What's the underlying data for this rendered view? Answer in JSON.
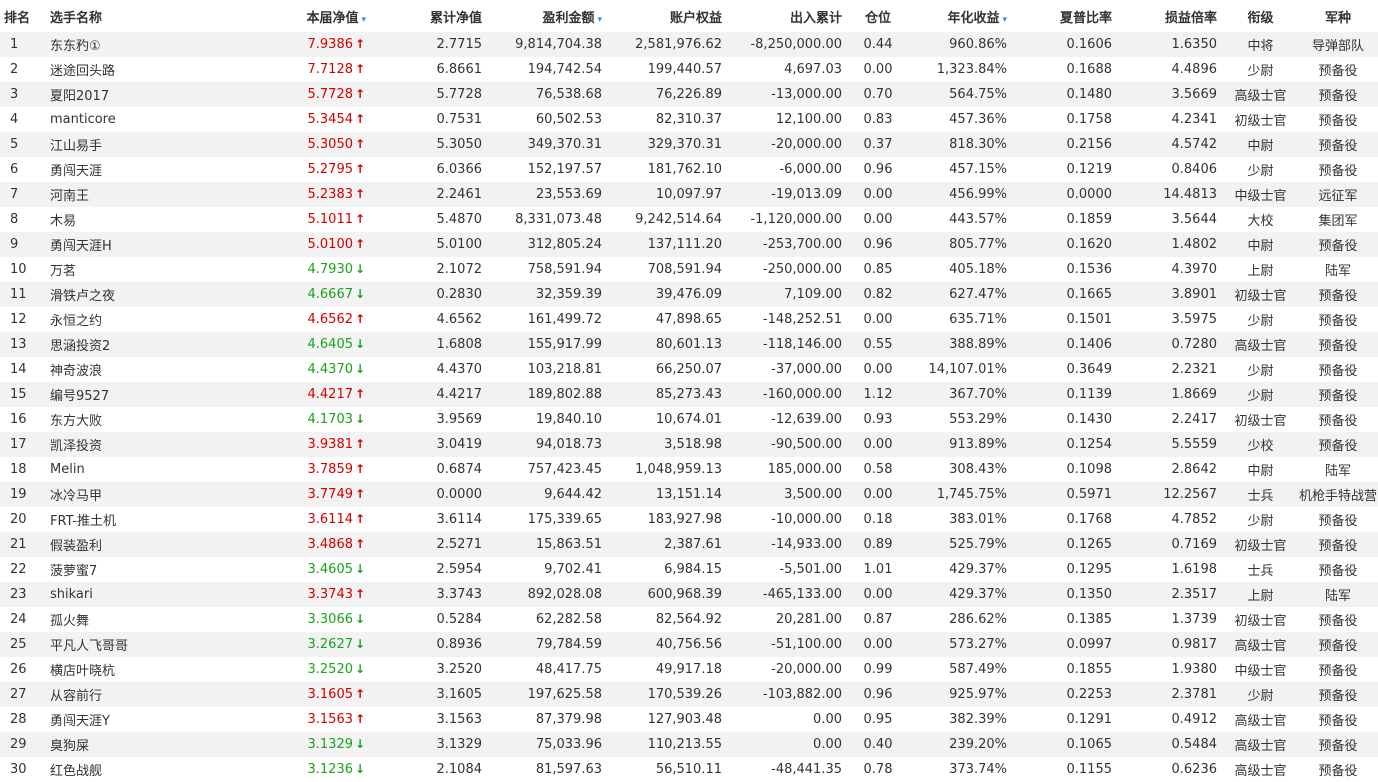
{
  "headers": {
    "rank": "排名",
    "name": "选手名称",
    "nav": "本届净值",
    "cum_nav": "累计净值",
    "profit": "盈利金额",
    "equity": "账户权益",
    "flow": "出入累计",
    "position": "仓位",
    "annual": "年化收益",
    "sharpe": "夏普比率",
    "pl_ratio": "损益倍率",
    "rank_title": "衔级",
    "branch": "军种",
    "sort_icon": "▾"
  },
  "colors": {
    "up": "#d40000",
    "down": "#1aa31a",
    "sort": "#3a8ee6",
    "stripe": "#f2f2f2"
  },
  "rows": [
    {
      "rank": "1",
      "name": "东东䂆①",
      "nav": "7.9386",
      "dir": "up",
      "cum": "2.7715",
      "profit": "9,814,704.38",
      "equity": "2,581,976.62",
      "flow": "-8,250,000.00",
      "pos": "0.44",
      "annual": "960.86%",
      "sharpe": "0.1606",
      "pl": "1.6350",
      "title": "中将",
      "branch": "导弹部队"
    },
    {
      "rank": "2",
      "name": "迷途回头路",
      "nav": "7.7128",
      "dir": "up",
      "cum": "6.8661",
      "profit": "194,742.54",
      "equity": "199,440.57",
      "flow": "4,697.03",
      "pos": "0.00",
      "annual": "1,323.84%",
      "sharpe": "0.1688",
      "pl": "4.4896",
      "title": "少尉",
      "branch": "预备役"
    },
    {
      "rank": "3",
      "name": "夏阳2017",
      "nav": "5.7728",
      "dir": "up",
      "cum": "5.7728",
      "profit": "76,538.68",
      "equity": "76,226.89",
      "flow": "-13,000.00",
      "pos": "0.70",
      "annual": "564.75%",
      "sharpe": "0.1480",
      "pl": "3.5669",
      "title": "高级士官",
      "branch": "预备役"
    },
    {
      "rank": "4",
      "name": "manticore",
      "nav": "5.3454",
      "dir": "up",
      "cum": "0.7531",
      "profit": "60,502.53",
      "equity": "82,310.37",
      "flow": "12,100.00",
      "pos": "0.83",
      "annual": "457.36%",
      "sharpe": "0.1758",
      "pl": "4.2341",
      "title": "初级士官",
      "branch": "预备役"
    },
    {
      "rank": "5",
      "name": "江山易手",
      "nav": "5.3050",
      "dir": "up",
      "cum": "5.3050",
      "profit": "349,370.31",
      "equity": "329,370.31",
      "flow": "-20,000.00",
      "pos": "0.37",
      "annual": "818.30%",
      "sharpe": "0.2156",
      "pl": "4.5742",
      "title": "中尉",
      "branch": "预备役"
    },
    {
      "rank": "6",
      "name": "勇闯天涯",
      "nav": "5.2795",
      "dir": "up",
      "cum": "6.0366",
      "profit": "152,197.57",
      "equity": "181,762.10",
      "flow": "-6,000.00",
      "pos": "0.96",
      "annual": "457.15%",
      "sharpe": "0.1219",
      "pl": "0.8406",
      "title": "少尉",
      "branch": "预备役"
    },
    {
      "rank": "7",
      "name": "河南王",
      "nav": "5.2383",
      "dir": "up",
      "cum": "2.2461",
      "profit": "23,553.69",
      "equity": "10,097.97",
      "flow": "-19,013.09",
      "pos": "0.00",
      "annual": "456.99%",
      "sharpe": "0.0000",
      "pl": "14.4813",
      "title": "中级士官",
      "branch": "远征军"
    },
    {
      "rank": "8",
      "name": "木易",
      "nav": "5.1011",
      "dir": "up",
      "cum": "5.4870",
      "profit": "8,331,073.48",
      "equity": "9,242,514.64",
      "flow": "-1,120,000.00",
      "pos": "0.00",
      "annual": "443.57%",
      "sharpe": "0.1859",
      "pl": "3.5644",
      "title": "大校",
      "branch": "集团军"
    },
    {
      "rank": "9",
      "name": "勇闯天涯H",
      "nav": "5.0100",
      "dir": "up",
      "cum": "5.0100",
      "profit": "312,805.24",
      "equity": "137,111.20",
      "flow": "-253,700.00",
      "pos": "0.96",
      "annual": "805.77%",
      "sharpe": "0.1620",
      "pl": "1.4802",
      "title": "中尉",
      "branch": "预备役"
    },
    {
      "rank": "10",
      "name": "万茗",
      "nav": "4.7930",
      "dir": "down",
      "cum": "2.1072",
      "profit": "758,591.94",
      "equity": "708,591.94",
      "flow": "-250,000.00",
      "pos": "0.85",
      "annual": "405.18%",
      "sharpe": "0.1536",
      "pl": "4.3970",
      "title": "上尉",
      "branch": "陆军"
    },
    {
      "rank": "11",
      "name": "滑铁卢之夜",
      "nav": "4.6667",
      "dir": "down",
      "cum": "0.2830",
      "profit": "32,359.39",
      "equity": "39,476.09",
      "flow": "7,109.00",
      "pos": "0.82",
      "annual": "627.47%",
      "sharpe": "0.1665",
      "pl": "3.8901",
      "title": "初级士官",
      "branch": "预备役"
    },
    {
      "rank": "12",
      "name": "永恒之约",
      "nav": "4.6562",
      "dir": "up",
      "cum": "4.6562",
      "profit": "161,499.72",
      "equity": "47,898.65",
      "flow": "-148,252.51",
      "pos": "0.00",
      "annual": "635.71%",
      "sharpe": "0.1501",
      "pl": "3.5975",
      "title": "少尉",
      "branch": "预备役"
    },
    {
      "rank": "13",
      "name": "思涵投资2",
      "nav": "4.6405",
      "dir": "down",
      "cum": "1.6808",
      "profit": "155,917.99",
      "equity": "80,601.13",
      "flow": "-118,146.00",
      "pos": "0.55",
      "annual": "388.89%",
      "sharpe": "0.1406",
      "pl": "0.7280",
      "title": "高级士官",
      "branch": "预备役"
    },
    {
      "rank": "14",
      "name": "神奇波浪",
      "nav": "4.4370",
      "dir": "down",
      "cum": "4.4370",
      "profit": "103,218.81",
      "equity": "66,250.07",
      "flow": "-37,000.00",
      "pos": "0.00",
      "annual": "14,107.01%",
      "sharpe": "0.3649",
      "pl": "2.2321",
      "title": "少尉",
      "branch": "预备役"
    },
    {
      "rank": "15",
      "name": "编号9527",
      "nav": "4.4217",
      "dir": "up",
      "cum": "4.4217",
      "profit": "189,802.88",
      "equity": "85,273.43",
      "flow": "-160,000.00",
      "pos": "1.12",
      "annual": "367.70%",
      "sharpe": "0.1139",
      "pl": "1.8669",
      "title": "少尉",
      "branch": "预备役"
    },
    {
      "rank": "16",
      "name": "东方大败",
      "nav": "4.1703",
      "dir": "down",
      "cum": "3.9569",
      "profit": "19,840.10",
      "equity": "10,674.01",
      "flow": "-12,639.00",
      "pos": "0.93",
      "annual": "553.29%",
      "sharpe": "0.1430",
      "pl": "2.2417",
      "title": "初级士官",
      "branch": "预备役"
    },
    {
      "rank": "17",
      "name": "凯泽投资",
      "nav": "3.9381",
      "dir": "up",
      "cum": "3.0419",
      "profit": "94,018.73",
      "equity": "3,518.98",
      "flow": "-90,500.00",
      "pos": "0.00",
      "annual": "913.89%",
      "sharpe": "0.1254",
      "pl": "5.5559",
      "title": "少校",
      "branch": "预备役"
    },
    {
      "rank": "18",
      "name": "Melin",
      "nav": "3.7859",
      "dir": "up",
      "cum": "0.6874",
      "profit": "757,423.45",
      "equity": "1,048,959.13",
      "flow": "185,000.00",
      "pos": "0.58",
      "annual": "308.43%",
      "sharpe": "0.1098",
      "pl": "2.8642",
      "title": "中尉",
      "branch": "陆军"
    },
    {
      "rank": "19",
      "name": "冰冷马甲",
      "nav": "3.7749",
      "dir": "up",
      "cum": "0.0000",
      "profit": "9,644.42",
      "equity": "13,151.14",
      "flow": "3,500.00",
      "pos": "0.00",
      "annual": "1,745.75%",
      "sharpe": "0.5971",
      "pl": "12.2567",
      "title": "士兵",
      "branch": "机枪手特战营"
    },
    {
      "rank": "20",
      "name": "FRT-推土机",
      "nav": "3.6114",
      "dir": "up",
      "cum": "3.6114",
      "profit": "175,339.65",
      "equity": "183,927.98",
      "flow": "-10,000.00",
      "pos": "0.18",
      "annual": "383.01%",
      "sharpe": "0.1768",
      "pl": "4.7852",
      "title": "少尉",
      "branch": "预备役"
    },
    {
      "rank": "21",
      "name": "假装盈利",
      "nav": "3.4868",
      "dir": "up",
      "cum": "2.5271",
      "profit": "15,863.51",
      "equity": "2,387.61",
      "flow": "-14,933.00",
      "pos": "0.89",
      "annual": "525.79%",
      "sharpe": "0.1265",
      "pl": "0.7169",
      "title": "初级士官",
      "branch": "预备役"
    },
    {
      "rank": "22",
      "name": "菠萝蜜7",
      "nav": "3.4605",
      "dir": "down",
      "cum": "2.5954",
      "profit": "9,702.41",
      "equity": "6,984.15",
      "flow": "-5,501.00",
      "pos": "1.01",
      "annual": "429.37%",
      "sharpe": "0.1295",
      "pl": "1.6198",
      "title": "士兵",
      "branch": "预备役"
    },
    {
      "rank": "23",
      "name": "shikari",
      "nav": "3.3743",
      "dir": "up",
      "cum": "3.3743",
      "profit": "892,028.08",
      "equity": "600,968.39",
      "flow": "-465,133.00",
      "pos": "0.00",
      "annual": "429.37%",
      "sharpe": "0.1350",
      "pl": "2.3517",
      "title": "上尉",
      "branch": "陆军"
    },
    {
      "rank": "24",
      "name": "孤火舞",
      "nav": "3.3066",
      "dir": "down",
      "cum": "0.5284",
      "profit": "62,282.58",
      "equity": "82,564.92",
      "flow": "20,281.00",
      "pos": "0.87",
      "annual": "286.62%",
      "sharpe": "0.1385",
      "pl": "1.3739",
      "title": "初级士官",
      "branch": "预备役"
    },
    {
      "rank": "25",
      "name": "平凡人飞哥哥",
      "nav": "3.2627",
      "dir": "down",
      "cum": "0.8936",
      "profit": "79,784.59",
      "equity": "40,756.56",
      "flow": "-51,100.00",
      "pos": "0.00",
      "annual": "573.27%",
      "sharpe": "0.0997",
      "pl": "0.9817",
      "title": "高级士官",
      "branch": "预备役"
    },
    {
      "rank": "26",
      "name": "横店叶晓杭",
      "nav": "3.2520",
      "dir": "down",
      "cum": "3.2520",
      "profit": "48,417.75",
      "equity": "49,917.18",
      "flow": "-20,000.00",
      "pos": "0.99",
      "annual": "587.49%",
      "sharpe": "0.1855",
      "pl": "1.9380",
      "title": "中级士官",
      "branch": "预备役"
    },
    {
      "rank": "27",
      "name": "从容前行",
      "nav": "3.1605",
      "dir": "up",
      "cum": "3.1605",
      "profit": "197,625.58",
      "equity": "170,539.26",
      "flow": "-103,882.00",
      "pos": "0.96",
      "annual": "925.97%",
      "sharpe": "0.2253",
      "pl": "2.3781",
      "title": "少尉",
      "branch": "预备役"
    },
    {
      "rank": "28",
      "name": "勇闯天涯Y",
      "nav": "3.1563",
      "dir": "up",
      "cum": "3.1563",
      "profit": "87,379.98",
      "equity": "127,903.48",
      "flow": "0.00",
      "pos": "0.95",
      "annual": "382.39%",
      "sharpe": "0.1291",
      "pl": "0.4912",
      "title": "高级士官",
      "branch": "预备役"
    },
    {
      "rank": "29",
      "name": "臭狗屎",
      "nav": "3.1329",
      "dir": "down",
      "cum": "3.1329",
      "profit": "75,033.96",
      "equity": "110,213.55",
      "flow": "0.00",
      "pos": "0.40",
      "annual": "239.20%",
      "sharpe": "0.1065",
      "pl": "0.5484",
      "title": "高级士官",
      "branch": "预备役"
    },
    {
      "rank": "30",
      "name": "红色战舰",
      "nav": "3.1236",
      "dir": "down",
      "cum": "2.1084",
      "profit": "81,597.63",
      "equity": "56,510.11",
      "flow": "-48,441.35",
      "pos": "0.78",
      "annual": "373.74%",
      "sharpe": "0.1155",
      "pl": "0.6236",
      "title": "高级士官",
      "branch": "预备役"
    }
  ]
}
